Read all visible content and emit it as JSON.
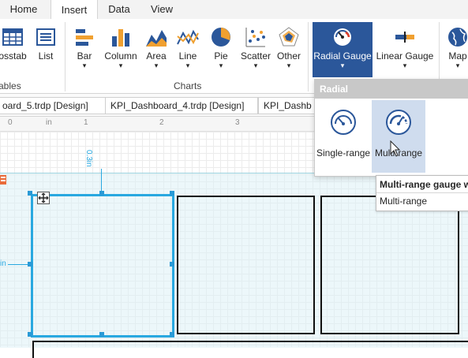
{
  "ribbon_tabs": [
    "Home",
    "Insert",
    "Data",
    "View"
  ],
  "active_tab": "Insert",
  "tables_group": {
    "crosstab_label": "osstab",
    "list_label": "List",
    "group_label": "ables"
  },
  "charts_group": {
    "group_label": "Charts",
    "buttons": [
      "Bar",
      "Column",
      "Area",
      "Line",
      "Pie",
      "Scatter",
      "Other"
    ]
  },
  "gauges": {
    "radial_label": "Radial Gauge",
    "linear_label": "Linear Gauge",
    "map_label": "Map"
  },
  "dropdown_arrow": "▾",
  "document_tabs": [
    "oard_5.trdp [Design]",
    "KPI_Dashboard_4.trdp [Design]",
    "KPI_Dashb"
  ],
  "ruler": {
    "unit": "in",
    "numbers": [
      "0",
      "1",
      "2",
      "3"
    ]
  },
  "measure_labels": {
    "vertical": "0.3in",
    "left": "in"
  },
  "radial_dropdown": {
    "header": "Radial",
    "items": [
      {
        "label": "Single-range"
      },
      {
        "label": "Multi-range"
      }
    ]
  },
  "tooltip": {
    "title": "Multi-range gauge wi",
    "body": "Multi-range"
  },
  "colors": {
    "accent": "#2b579a",
    "selection": "#29a8e0",
    "band": "#dcf0f5"
  }
}
